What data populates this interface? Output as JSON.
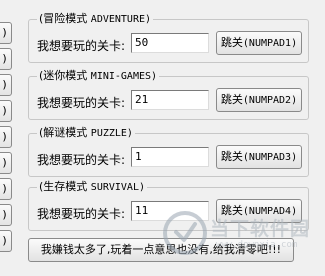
{
  "side_buttons": [
    {
      "label": ")"
    },
    {
      "label": ")"
    },
    {
      "label": ")"
    },
    {
      "label": ")"
    },
    {
      "label": ")"
    },
    {
      "label": ")"
    },
    {
      "label": ")"
    },
    {
      "label": ")"
    },
    {
      "label": ")"
    }
  ],
  "modes": [
    {
      "title_cn": "(冒险模式",
      "title_en": "ADVENTURE)",
      "prompt": "我想要玩的关卡:",
      "level": "50",
      "jump_cn": "跳关",
      "jump_en": "(NUMPAD1)"
    },
    {
      "title_cn": "(迷你模式",
      "title_en": "MINI-GAMES)",
      "prompt": "我想要玩的关卡:",
      "level": "21",
      "jump_cn": "跳关",
      "jump_en": "(NUMPAD2)"
    },
    {
      "title_cn": "(解谜模式",
      "title_en": "PUZZLE)",
      "prompt": "我想要玩的关卡:",
      "level": "1",
      "jump_cn": "跳关",
      "jump_en": "(NUMPAD3)"
    },
    {
      "title_cn": "(生存模式",
      "title_en": "SURVIVAL)",
      "prompt": "我想要玩的关卡:",
      "level": "11",
      "jump_cn": "跳关",
      "jump_en": "(NUMPAD4)"
    }
  ],
  "bottom_button": "我嫌钱太多了,玩着一点意思也没有,给我清零吧!!!",
  "watermark": {
    "text": "当下软件园",
    "url": "www.downxia.com"
  }
}
